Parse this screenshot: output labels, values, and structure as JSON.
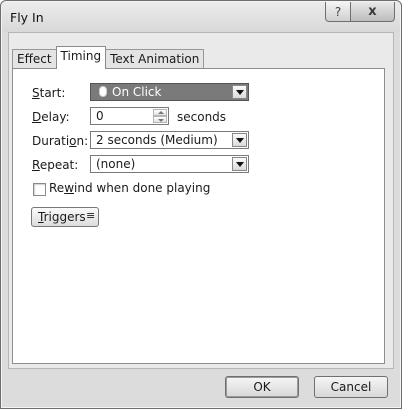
{
  "window": {
    "title": "Fly In",
    "help_label": "?",
    "close_label": "x"
  },
  "tabs": [
    {
      "label": "Effect",
      "active": false
    },
    {
      "label": "Timing",
      "active": true
    },
    {
      "label": "Text Animation",
      "active": false
    }
  ],
  "timing": {
    "start": {
      "label_mnemonic": "S",
      "label_rest": "tart:",
      "value": "On Click",
      "icon": "mouse-icon"
    },
    "delay": {
      "label_mnemonic": "D",
      "label_rest": "elay:",
      "value": "0",
      "unit": "seconds"
    },
    "duration": {
      "label_pre": "Durati",
      "label_mnemonic": "o",
      "label_rest": "n:",
      "value": "2 seconds (Medium)"
    },
    "repeat": {
      "label_mnemonic": "R",
      "label_rest": "epeat:",
      "value": "(none)"
    },
    "rewind": {
      "label_pre": "Re",
      "label_mnemonic": "w",
      "label_rest": "ind when done playing",
      "checked": false
    },
    "triggers": {
      "label_mnemonic": "T",
      "label_rest": "riggers",
      "chevron": "≡"
    }
  },
  "buttons": {
    "ok": "OK",
    "cancel": "Cancel"
  },
  "colors": {
    "window_bg": "#dcdcdc",
    "selected_combo": "#7a7a7a"
  }
}
